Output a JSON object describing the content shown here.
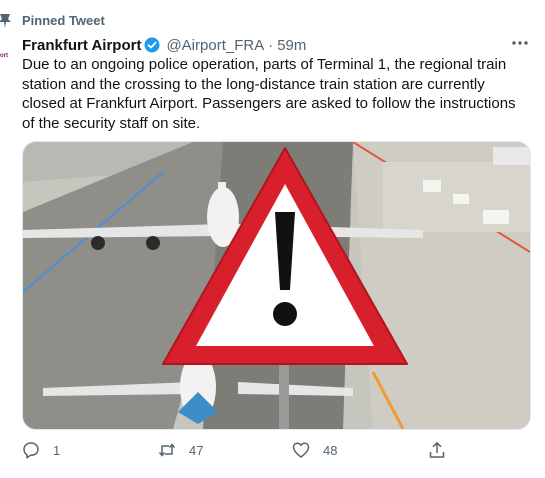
{
  "pinned": {
    "label": "Pinned Tweet"
  },
  "avatar": {
    "text": "ort"
  },
  "tweet": {
    "display_name": "Frankfurt Airport",
    "handle": "@Airport_FRA",
    "separator": "·",
    "time": "59m",
    "text": "Due to an ongoing police operation, parts of Terminal 1, the regional train station and the crossing to the long-distance train station are currently closed at Frankfurt Airport. Passengers are asked to follow the instructions of the security staff on site."
  },
  "actions": {
    "reply_count": "1",
    "retweet_count": "47",
    "like_count": "48"
  },
  "icons": {
    "pin": "pin-icon",
    "verified": "verified-badge-icon",
    "more": "more-options-icon",
    "reply": "reply-icon",
    "retweet": "retweet-icon",
    "like": "heart-icon",
    "share": "share-icon"
  },
  "colors": {
    "text_primary": "#0f1419",
    "text_secondary": "#536471",
    "verified_blue": "#1d9bf0",
    "warning_red": "#d8202c"
  }
}
